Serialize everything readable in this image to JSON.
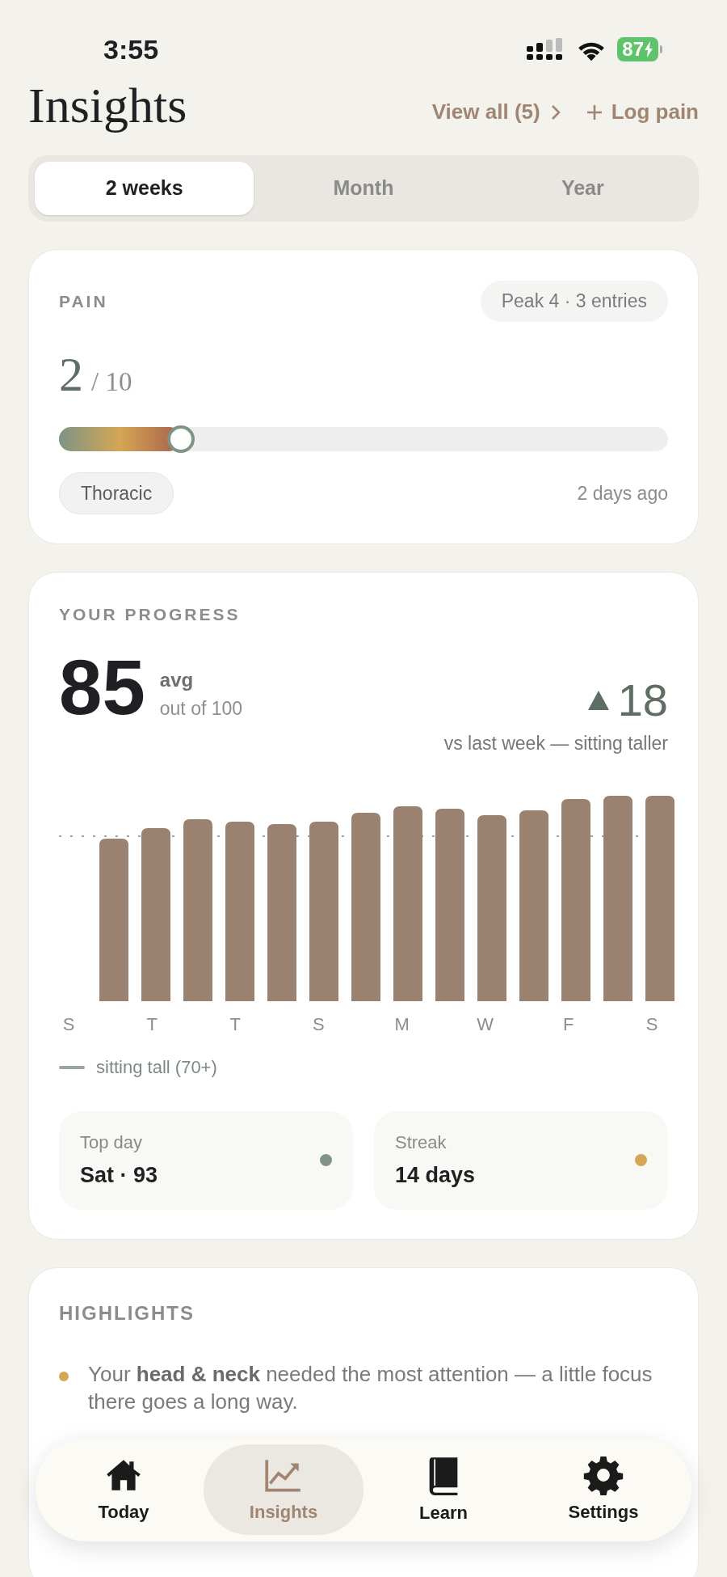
{
  "status_bar": {
    "time": "3:55",
    "battery": "87"
  },
  "header": {
    "title": "Insights",
    "view_all": "View all (5)",
    "log_pain": "Log pain"
  },
  "tabs": [
    {
      "label": "2 weeks",
      "selected": true
    },
    {
      "label": "Month",
      "selected": false
    },
    {
      "label": "Year",
      "selected": false
    }
  ],
  "pain": {
    "heading": "PAIN",
    "summary": "Peak 4 · 3 entries",
    "score": "2",
    "scale": "/ 10",
    "level": 0.2,
    "region": "Thoracic",
    "when": "2 days ago"
  },
  "progress": {
    "heading": "YOUR PROGRESS",
    "score": "85",
    "score_label": "avg",
    "score_scale": "out of 100",
    "change": "18",
    "change_label": "vs last week — sitting taller",
    "day_labels": [
      "S",
      "T",
      "T",
      "S",
      "M",
      "W",
      "F",
      "S"
    ],
    "legend": "sitting tall (70+)",
    "stats": [
      {
        "label": "Top day",
        "value": "Sat · 93",
        "color": "#7f9486"
      },
      {
        "label": "Streak",
        "value": "14 days",
        "color": "#d4a655"
      }
    ]
  },
  "highlights": {
    "heading": "HIGHLIGHTS",
    "items": [
      {
        "text": "Your **head & neck** needed the most attention — a little focus there goes a long way.",
        "color": "#d4a655"
      }
    ]
  },
  "nav": [
    {
      "label": "Today",
      "kind": "home",
      "selected": false
    },
    {
      "label": "Insights",
      "kind": "chart",
      "selected": true
    },
    {
      "label": "Learn",
      "kind": "book",
      "selected": false
    },
    {
      "label": "Settings",
      "kind": "gear",
      "selected": false
    }
  ]
}
